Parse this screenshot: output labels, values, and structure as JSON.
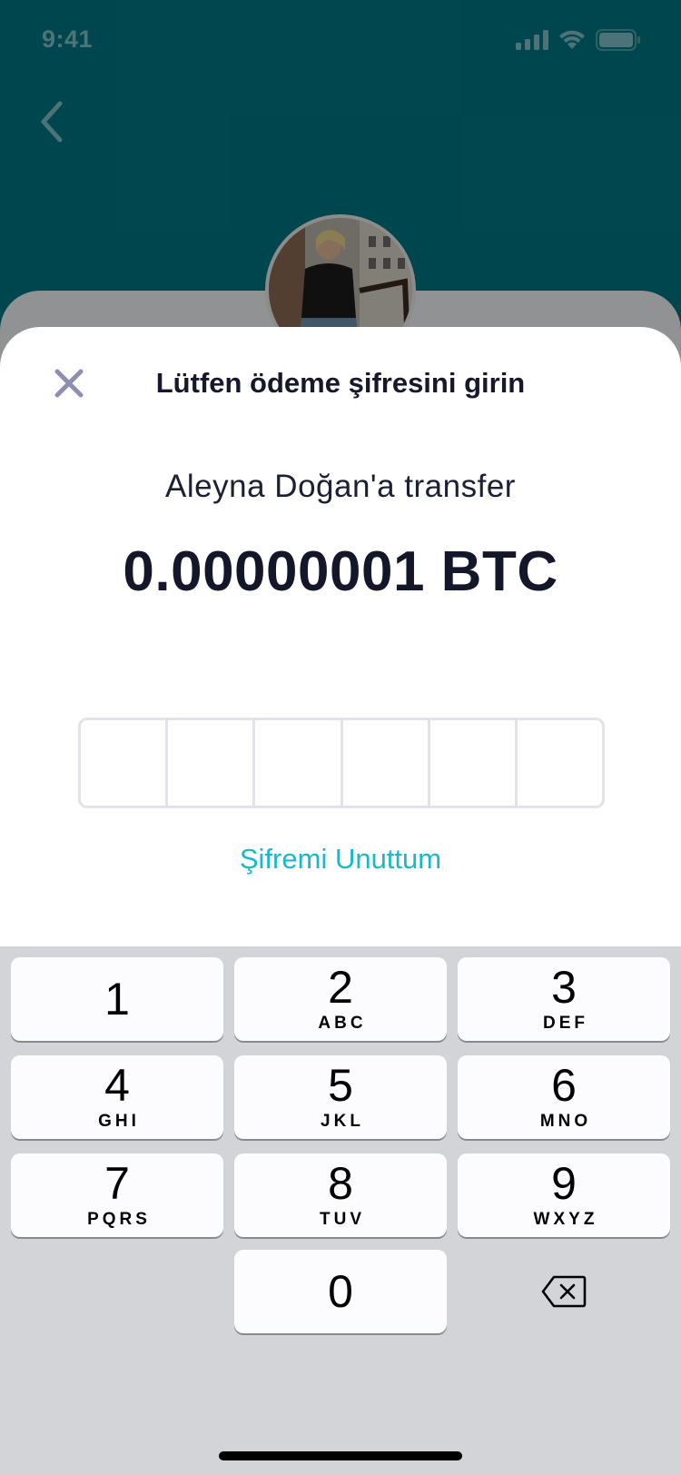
{
  "status_bar": {
    "time": "9:41"
  },
  "header": {
    "back_icon": "chevron-left-icon"
  },
  "sheet": {
    "title": "Lütfen ödeme şifresini girin",
    "transfer_label": "Aleyna Doğan'a transfer",
    "amount": "0.00000001 BTC",
    "pin_length": 6,
    "forgot_link": "Şifremi Unuttum"
  },
  "keypad": {
    "keys": [
      {
        "digit": "1",
        "letters": ""
      },
      {
        "digit": "2",
        "letters": "ABC"
      },
      {
        "digit": "3",
        "letters": "DEF"
      },
      {
        "digit": "4",
        "letters": "GHI"
      },
      {
        "digit": "5",
        "letters": "JKL"
      },
      {
        "digit": "6",
        "letters": "MNO"
      },
      {
        "digit": "7",
        "letters": "PQRS"
      },
      {
        "digit": "8",
        "letters": "TUV"
      },
      {
        "digit": "9",
        "letters": "WXYZ"
      },
      {
        "digit": "0",
        "letters": ""
      }
    ],
    "delete_icon": "backspace-icon"
  },
  "colors": {
    "header_teal": "#007683",
    "link": "#1ab8cc",
    "title_text": "#17182b"
  }
}
